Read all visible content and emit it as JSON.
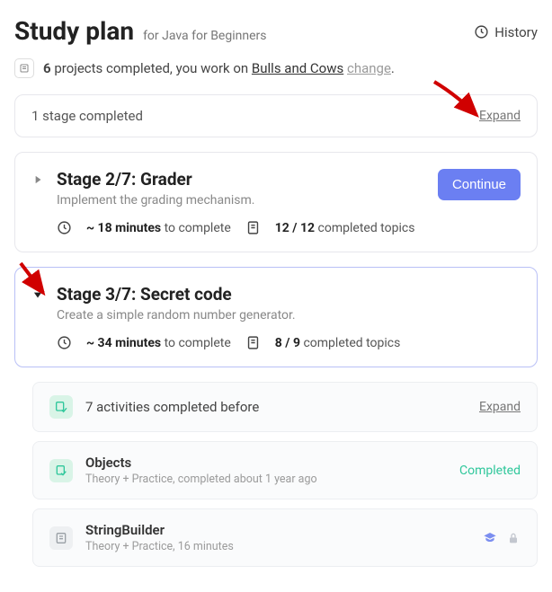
{
  "header": {
    "title": "Study plan",
    "subtitle": "for Java for Beginners",
    "history": "History"
  },
  "projects": {
    "count": "6",
    "text_mid": " projects completed, you work on ",
    "current": "Bulls and Cows",
    "change": "change"
  },
  "stage1": {
    "label": "1 stage completed",
    "expand": "Expand"
  },
  "stage2": {
    "title": "Stage 2/7: Grader",
    "desc": "Implement the grading mechanism.",
    "time_bold": "~ 18 minutes",
    "time_rest": " to complete",
    "topics_bold": "12 / 12",
    "topics_rest": " completed topics",
    "continue": "Continue"
  },
  "stage3": {
    "title": "Stage 3/7: Secret code",
    "desc": "Create a simple random number generator.",
    "time_bold": "~ 34 minutes",
    "time_rest": " to complete",
    "topics_bold": "8 / 9",
    "topics_rest": " completed topics"
  },
  "activities": {
    "label": "7 activities completed before",
    "expand": "Expand"
  },
  "topic_objects": {
    "title": "Objects",
    "sub": "Theory + Practice, completed about 1 year ago",
    "status": "Completed"
  },
  "topic_sb": {
    "title": "StringBuilder",
    "sub": "Theory + Practice, 16 minutes"
  }
}
